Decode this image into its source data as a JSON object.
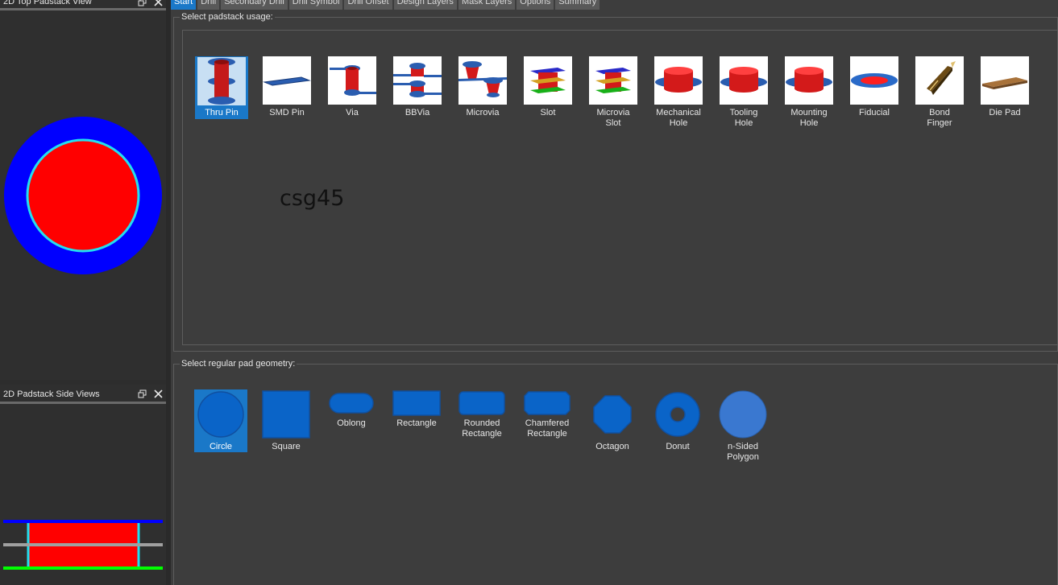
{
  "left_panels": {
    "top_view": {
      "title": "2D Top Padstack View"
    },
    "side_view": {
      "title": "2D Padstack Side Views"
    }
  },
  "tabs": [
    {
      "label": "Start",
      "active": true
    },
    {
      "label": "Drill",
      "active": false
    },
    {
      "label": "Secondary Drill",
      "active": false
    },
    {
      "label": "Drill Symbol",
      "active": false
    },
    {
      "label": "Drill Offset",
      "active": false
    },
    {
      "label": "Design Layers",
      "active": false
    },
    {
      "label": "Mask Layers",
      "active": false
    },
    {
      "label": "Options",
      "active": false
    },
    {
      "label": "Summary",
      "active": false
    }
  ],
  "usage": {
    "group_label": "Select padstack usage:",
    "selected": "Thru Pin",
    "items": [
      {
        "label": "Thru Pin",
        "icon": "thru-pin-icon"
      },
      {
        "label": "SMD Pin",
        "icon": "smd-pin-icon"
      },
      {
        "label": "Via",
        "icon": "via-icon"
      },
      {
        "label": "BBVia",
        "icon": "bbvia-icon"
      },
      {
        "label": "Microvia",
        "icon": "microvia-icon"
      },
      {
        "label": "Slot",
        "icon": "slot-icon"
      },
      {
        "label": "Microvia\nSlot",
        "icon": "microvia-slot-icon"
      },
      {
        "label": "Mechanical\nHole",
        "icon": "mechanical-hole-icon"
      },
      {
        "label": "Tooling\nHole",
        "icon": "tooling-hole-icon"
      },
      {
        "label": "Mounting\nHole",
        "icon": "mounting-hole-icon"
      },
      {
        "label": "Fiducial",
        "icon": "fiducial-icon"
      },
      {
        "label": "Bond\nFinger",
        "icon": "bond-finger-icon"
      },
      {
        "label": "Die Pad",
        "icon": "die-pad-icon"
      }
    ]
  },
  "padstack_name": "csg45",
  "geometry": {
    "group_label": "Select regular pad geometry:",
    "selected": "Circle",
    "items": [
      {
        "label": "Circle",
        "icon": "circle-shape-icon"
      },
      {
        "label": "Square",
        "icon": "square-shape-icon"
      },
      {
        "label": "Oblong",
        "icon": "oblong-shape-icon"
      },
      {
        "label": "Rectangle",
        "icon": "rectangle-shape-icon"
      },
      {
        "label": "Rounded\nRectangle",
        "icon": "rounded-rectangle-shape-icon"
      },
      {
        "label": "Chamfered\nRectangle",
        "icon": "chamfered-rectangle-shape-icon"
      },
      {
        "label": "Octagon",
        "icon": "octagon-shape-icon"
      },
      {
        "label": "Donut",
        "icon": "donut-shape-icon"
      },
      {
        "label": "n-Sided\nPolygon",
        "icon": "n-sided-polygon-shape-icon"
      }
    ]
  },
  "colors": {
    "pad_blue": "#0000ff",
    "drill_red": "#ff0000",
    "outline_cyan": "#22e0f0",
    "accent": "#1a78c8",
    "side_bottom_green": "#00ff00",
    "side_middle_gray": "#a0a0a0"
  }
}
